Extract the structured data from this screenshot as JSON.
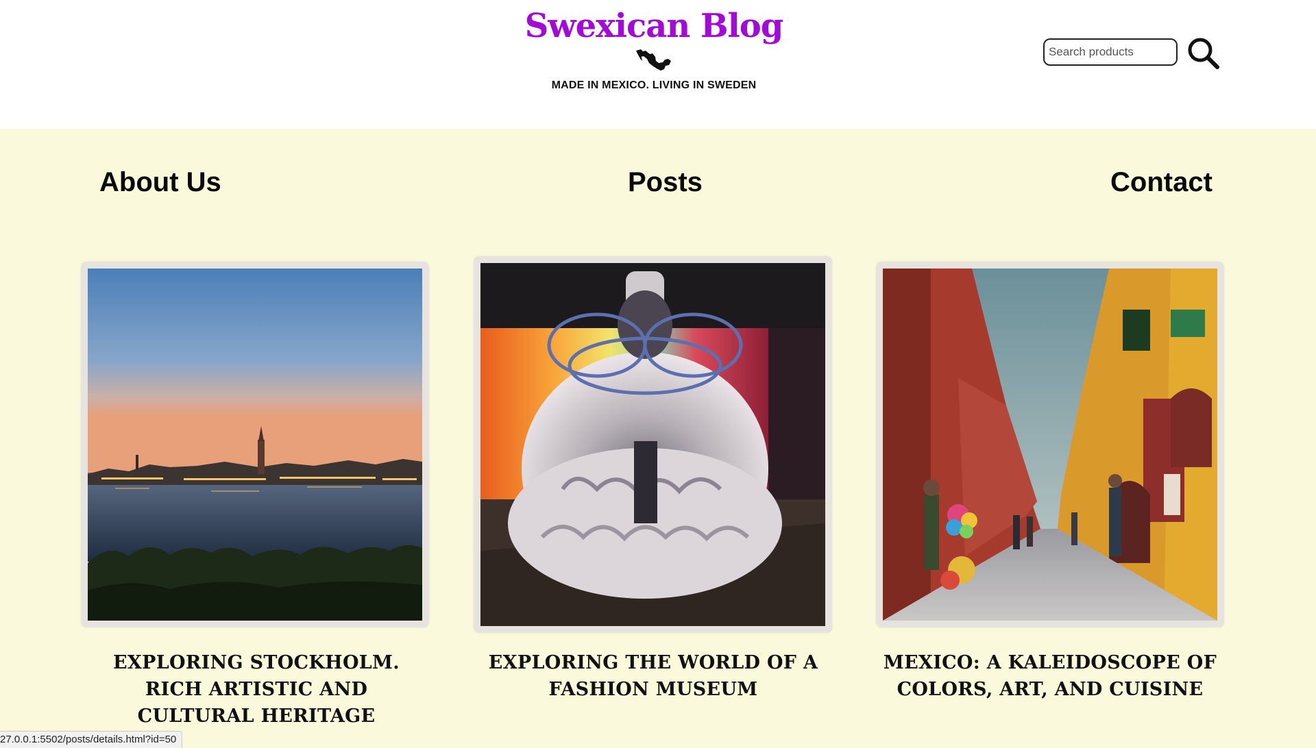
{
  "header": {
    "brand_title": "Swexican Blog",
    "tagline": "MADE IN MEXICO. LIVING IN SWEDEN",
    "brand_icon": "mexico-map-icon",
    "search_placeholder": "Search products",
    "search_icon": "search-icon"
  },
  "colors": {
    "brand": "#a20ad8",
    "page_background": "#fbf9dc",
    "header_background": "#ffffff"
  },
  "nav": {
    "about": "About Us",
    "posts": "Posts",
    "contact": "Contact"
  },
  "posts": [
    {
      "title": "EXPLORING STOCKHOLM. RICH ARTISTIC AND CULTURAL HERITAGE",
      "image": "stockholm-skyline-photo"
    },
    {
      "title": "EXPLORING THE WORLD OF A FASHION MUSEUM",
      "image": "fashion-sculpture-photo"
    },
    {
      "title": "MEXICO: A KALEIDOSCOPE OF COLORS, ART, AND CUISINE",
      "image": "mexican-street-photo"
    }
  ],
  "status_bar": {
    "url": "27.0.0.1:5502/posts/details.html?id=50"
  }
}
